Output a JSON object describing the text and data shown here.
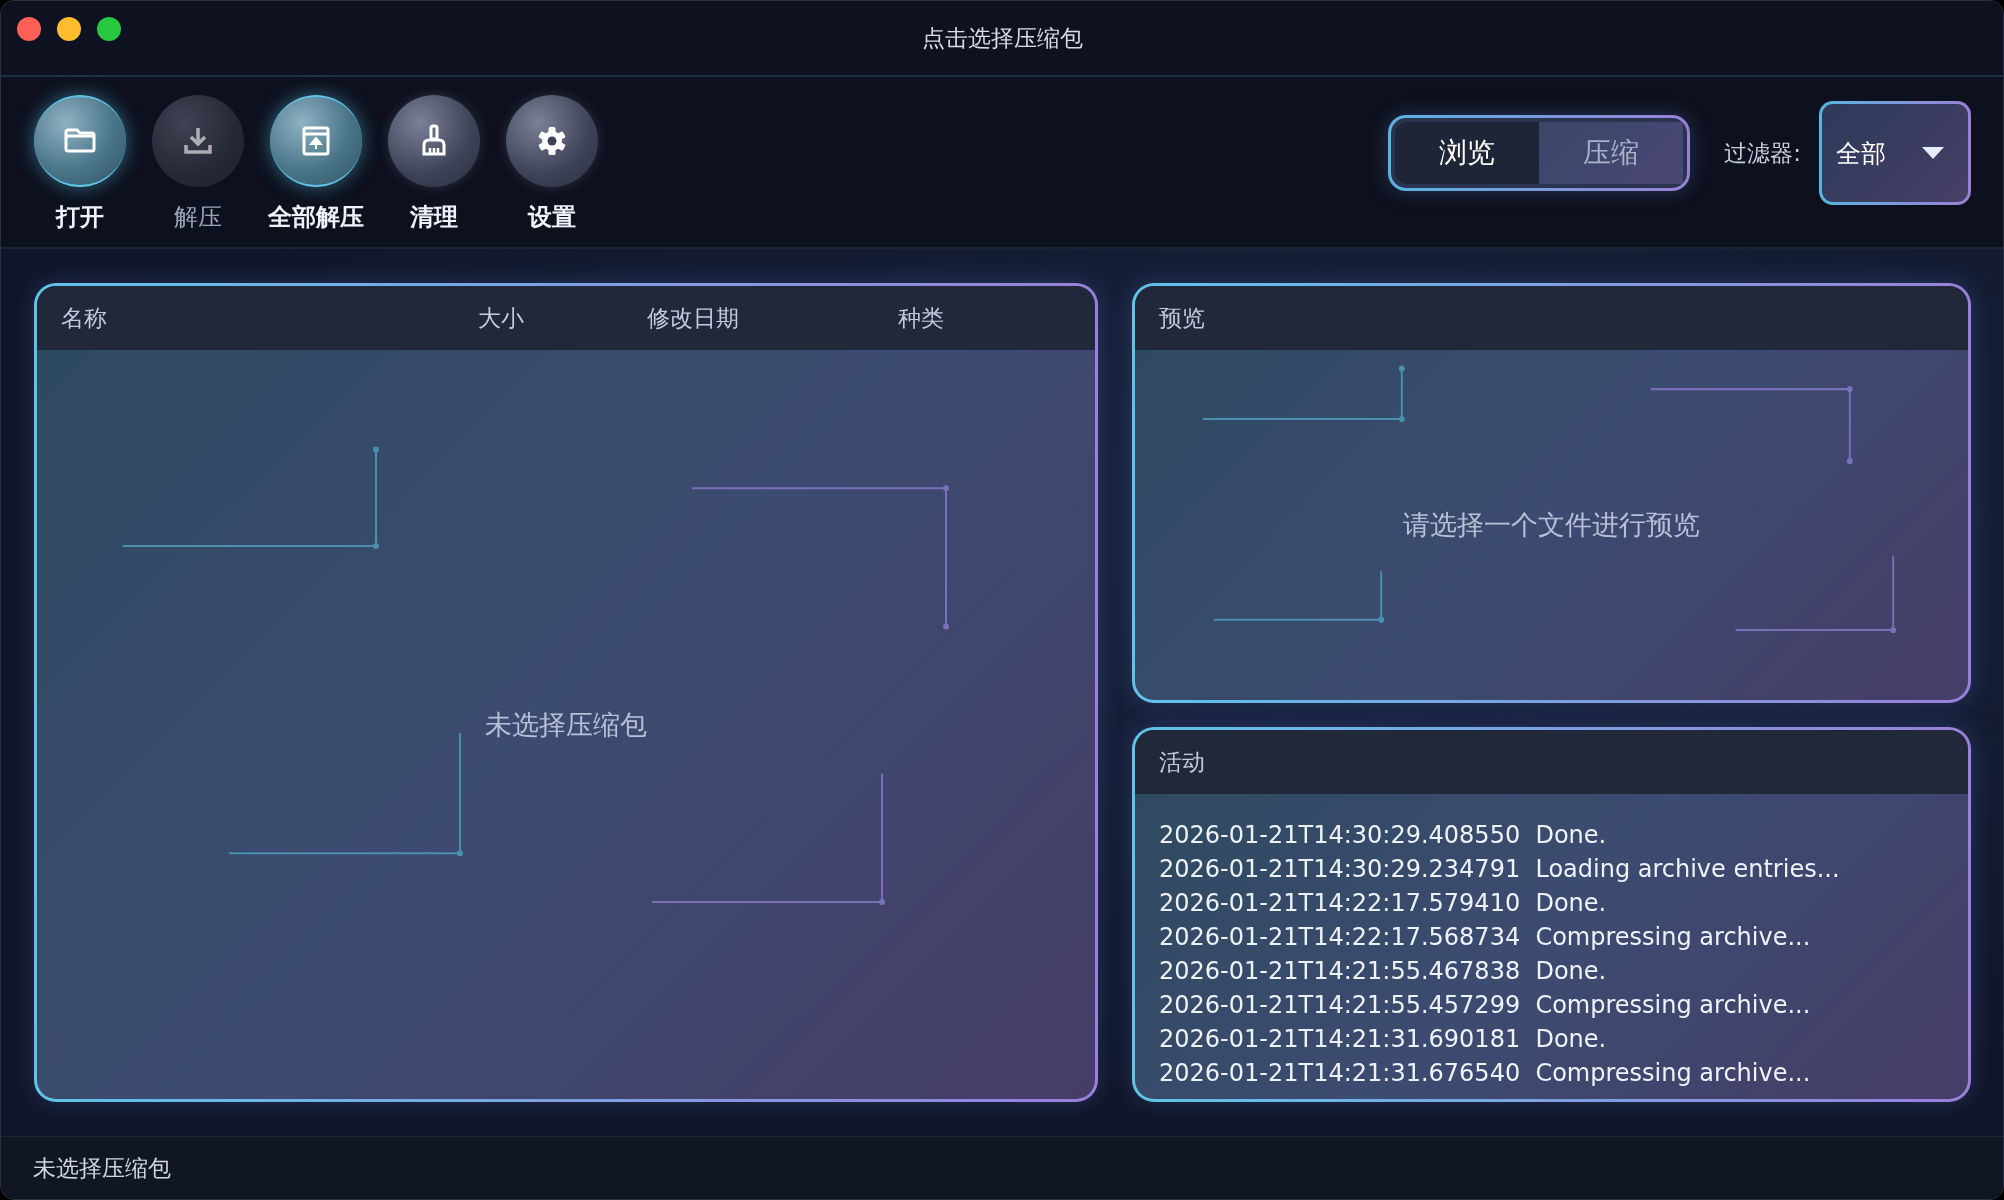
{
  "window": {
    "title": "点击选择压缩包"
  },
  "toolbar": {
    "buttons": [
      {
        "label": "打开",
        "accent": true,
        "disabled": false
      },
      {
        "label": "解压",
        "accent": false,
        "disabled": true
      },
      {
        "label": "全部解压",
        "accent": true,
        "disabled": false
      },
      {
        "label": "清理",
        "accent": false,
        "disabled": false
      },
      {
        "label": "设置",
        "accent": false,
        "disabled": false
      }
    ]
  },
  "mode_tabs": [
    {
      "label": "浏览",
      "selected": true
    },
    {
      "label": "压缩",
      "selected": false
    }
  ],
  "filter": {
    "label": "过滤器:",
    "value": "全部"
  },
  "file_table": {
    "columns": [
      "名称",
      "大小",
      "修改日期",
      "种类"
    ],
    "empty_message": "未选择压缩包"
  },
  "preview": {
    "title": "预览",
    "message": "请选择一个文件进行预览"
  },
  "activity": {
    "title": "活动",
    "entries": [
      "2026-01-21T14:30:29.408550  Done.",
      "2026-01-21T14:30:29.234791  Loading archive entries...",
      "2026-01-21T14:22:17.579410  Done.",
      "2026-01-21T14:22:17.568734  Compressing archive...",
      "2026-01-21T14:21:55.467838  Done.",
      "2026-01-21T14:21:55.457299  Compressing archive...",
      "2026-01-21T14:21:31.690181  Done.",
      "2026-01-21T14:21:31.676540  Compressing archive..."
    ]
  },
  "status_bar": {
    "text": "未选择压缩包"
  }
}
